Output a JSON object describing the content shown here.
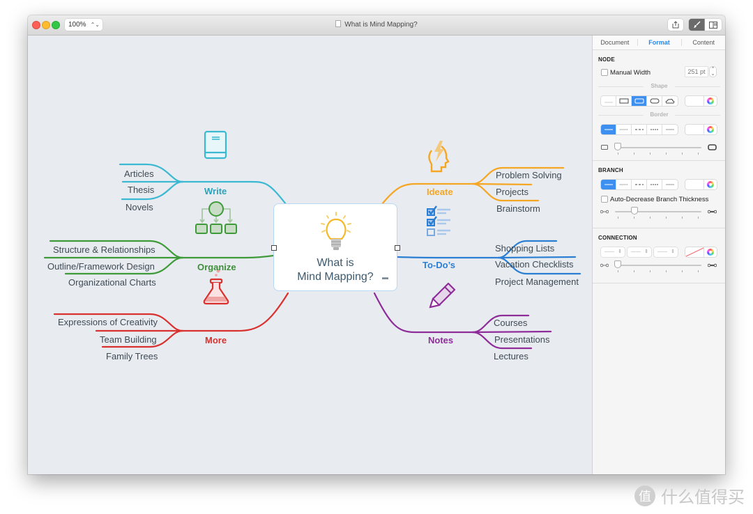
{
  "window": {
    "zoom_level": "100%",
    "document_title": "What is Mind Mapping?",
    "toolbar": {
      "share_icon": "share-icon",
      "format_icon": "brush-icon",
      "sidebar_icon": "sidebar-toggle-icon"
    }
  },
  "mindmap": {
    "center": {
      "line1": "What is",
      "line2": "Mind Mapping?",
      "icon": "lightbulb-icon"
    },
    "branches": [
      {
        "label": "Write",
        "color": "#3bb9d2",
        "icon": "book-icon",
        "children": [
          "Articles",
          "Thesis",
          "Novels"
        ]
      },
      {
        "label": "Organize",
        "color": "#3f9a3a",
        "icon": "hierarchy-icon",
        "children": [
          "Structure & Relationships",
          "Outline/Framework Design",
          "Organizational Charts"
        ]
      },
      {
        "label": "More",
        "color": "#d9312f",
        "icon": "flask-icon",
        "children": [
          "Expressions of Creativity",
          "Team Building",
          "Family Trees"
        ]
      },
      {
        "label": "Ideate",
        "color": "#f5a623",
        "icon": "head-lightning-icon",
        "children": [
          "Problem Solving",
          "Projects",
          "Brainstorm"
        ]
      },
      {
        "label": "To-Do’s",
        "color": "#2a7fd4",
        "icon": "checklist-icon",
        "children": [
          "Shopping Lists",
          "Vacation Checklists",
          "Project Management"
        ]
      },
      {
        "label": "Notes",
        "color": "#8e2c9a",
        "icon": "pencil-icon",
        "children": [
          "Courses",
          "Presentations",
          "Lectures"
        ]
      }
    ]
  },
  "inspector": {
    "tabs": [
      "Document",
      "Format",
      "Content"
    ],
    "active_tab": "Format",
    "node": {
      "heading": "NODE",
      "manual_width_label": "Manual Width",
      "manual_width_checked": false,
      "width_value": "251 pt",
      "shape_label": "Shape",
      "shape_options": [
        "none",
        "rectangle",
        "rounded-rectangle",
        "ellipse",
        "cloud"
      ],
      "shape_selected": "rounded-rectangle",
      "border_label": "Border",
      "border_options": [
        "solid",
        "dotted",
        "dashed",
        "dash-dot",
        "thin"
      ],
      "border_selected": "solid",
      "corner_radius_fraction": 0.0
    },
    "branch": {
      "heading": "BRANCH",
      "style_options": [
        "solid",
        "dotted",
        "dashed",
        "dash-dot",
        "thin"
      ],
      "style_selected": "solid",
      "auto_decrease_label": "Auto-Decrease Branch Thickness",
      "auto_decrease_checked": false,
      "thickness_fraction": 0.2
    },
    "connection": {
      "heading": "CONNECTION",
      "color": "#f26b6b",
      "thickness_fraction": 0.0
    }
  },
  "watermark": {
    "badge": "值",
    "text": "什么值得买"
  }
}
